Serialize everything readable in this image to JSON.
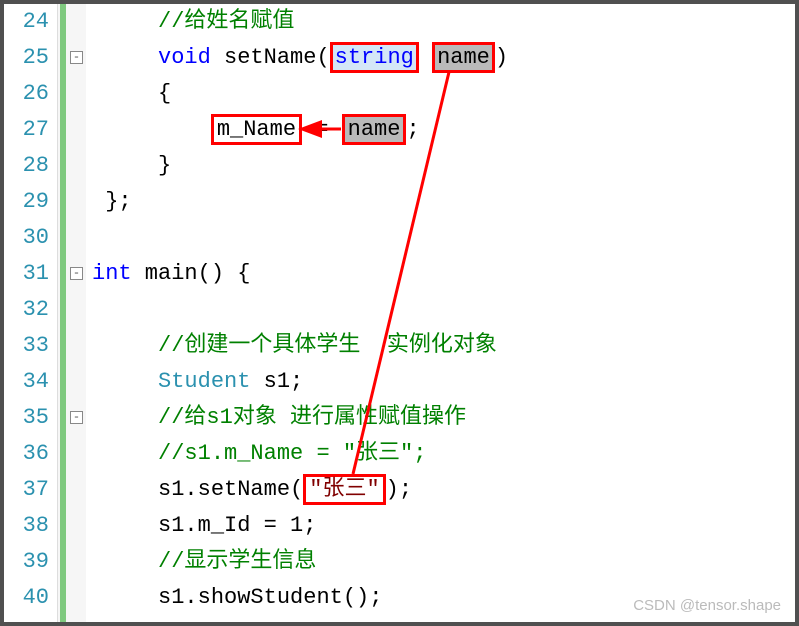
{
  "lineNumbers": [
    "24",
    "25",
    "26",
    "27",
    "28",
    "29",
    "30",
    "31",
    "32",
    "33",
    "34",
    "35",
    "36",
    "37",
    "38",
    "39",
    "40"
  ],
  "code": {
    "l24_comment": "//给姓名赋值",
    "l25_void": "void",
    "l25_fn": " setName(",
    "l25_string": "string",
    "l25_space": " ",
    "l25_name": "name",
    "l25_close": ")",
    "l26": "{",
    "l27_lhs": "m_Name",
    "l27_eq": " = ",
    "l27_rhs": "name",
    "l27_semi": ";",
    "l28": "}",
    "l29": "};",
    "l31_int": "int",
    "l31_main": " main() {",
    "l33_comment": "//创建一个具体学生  实例化对象",
    "l34_type": "Student",
    "l34_var": " s1;",
    "l35_comment": "//给s1对象 进行属性赋值操作",
    "l36_comment": "//s1.m_Name = \"张三\";",
    "l37_call": "s1.setName(",
    "l37_arg": "\"张三\"",
    "l37_close": ");",
    "l38": "s1.m_Id = 1;",
    "l39_comment": "//显示学生信息",
    "l40": "s1.showStudent();"
  },
  "foldMarkers": {
    "m25": "-",
    "m31": "-",
    "m35": "-"
  },
  "watermark": "CSDN @tensor.shape"
}
